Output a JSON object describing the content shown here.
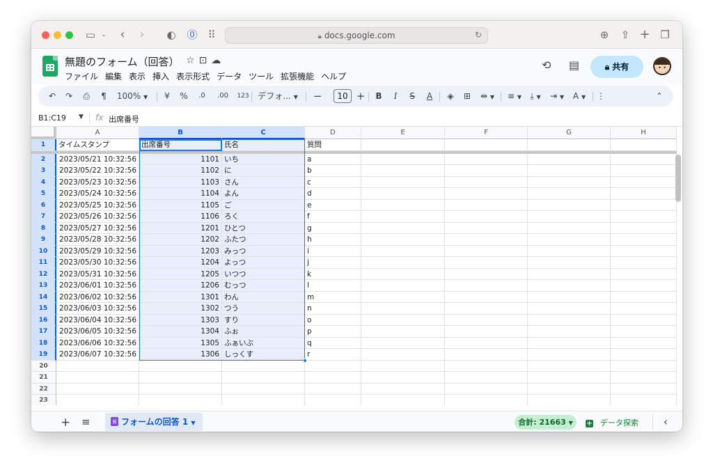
{
  "browser": {
    "url": "docs.google.com"
  },
  "doc": {
    "title": "無題のフォーム（回答）",
    "menu": [
      "ファイル",
      "編集",
      "表示",
      "挿入",
      "表示形式",
      "データ",
      "ツール",
      "拡張機能",
      "ヘルプ"
    ],
    "share_label": "共有"
  },
  "toolbar": {
    "zoom": "100%",
    "currency": "¥",
    "percent": "%",
    "dec_decrease": ".0",
    "dec_increase": ".00",
    "number_format": "123",
    "font": "デフォ...",
    "font_size": "10"
  },
  "formula_bar": {
    "range": "B1:C19",
    "fx": "fx",
    "content": "出席番号"
  },
  "sheet": {
    "columns": [
      "A",
      "B",
      "C",
      "D",
      "E",
      "F",
      "G",
      "H"
    ],
    "headers": [
      "タイムスタンプ",
      "出席番号",
      "氏名",
      "質問"
    ],
    "rows": [
      [
        "2023/05/21 10:32:56",
        "1101",
        "いち",
        "a"
      ],
      [
        "2023/05/22 10:32:56",
        "1102",
        "に",
        "b"
      ],
      [
        "2023/05/23 10:32:56",
        "1103",
        "さん",
        "c"
      ],
      [
        "2023/05/24 10:32:56",
        "1104",
        "よん",
        "d"
      ],
      [
        "2023/05/25 10:32:56",
        "1105",
        "ご",
        "e"
      ],
      [
        "2023/05/26 10:32:56",
        "1106",
        "ろく",
        "f"
      ],
      [
        "2023/05/27 10:32:56",
        "1201",
        "ひとつ",
        "g"
      ],
      [
        "2023/05/28 10:32:56",
        "1202",
        "ふたつ",
        "h"
      ],
      [
        "2023/05/29 10:32:56",
        "1203",
        "みっつ",
        "i"
      ],
      [
        "2023/05/30 10:32:56",
        "1204",
        "よっつ",
        "j"
      ],
      [
        "2023/05/31 10:32:56",
        "1205",
        "いつつ",
        "k"
      ],
      [
        "2023/06/01 10:32:56",
        "1206",
        "むっつ",
        "l"
      ],
      [
        "2023/06/02 10:32:56",
        "1301",
        "わん",
        "m"
      ],
      [
        "2023/06/03 10:32:56",
        "1302",
        "つう",
        "n"
      ],
      [
        "2023/06/04 10:32:56",
        "1303",
        "すり",
        "o"
      ],
      [
        "2023/06/05 10:32:56",
        "1304",
        "ふぉ",
        "p"
      ],
      [
        "2023/06/06 10:32:56",
        "1305",
        "ふぁいぶ",
        "q"
      ],
      [
        "2023/06/07 10:32:56",
        "1306",
        "しっくす",
        "r"
      ]
    ],
    "empty_row_numbers": [
      "20",
      "21",
      "22",
      "23"
    ]
  },
  "bottom": {
    "sheet_tab": "フォームの回答 1",
    "sum": "合計: 21663",
    "explore": "データ探索"
  },
  "colors": {
    "selection_fill": "#e8eefb",
    "selection_border": "#1a73e8",
    "share_button": "#c2e7ff",
    "sheets_green": "#23a566"
  }
}
